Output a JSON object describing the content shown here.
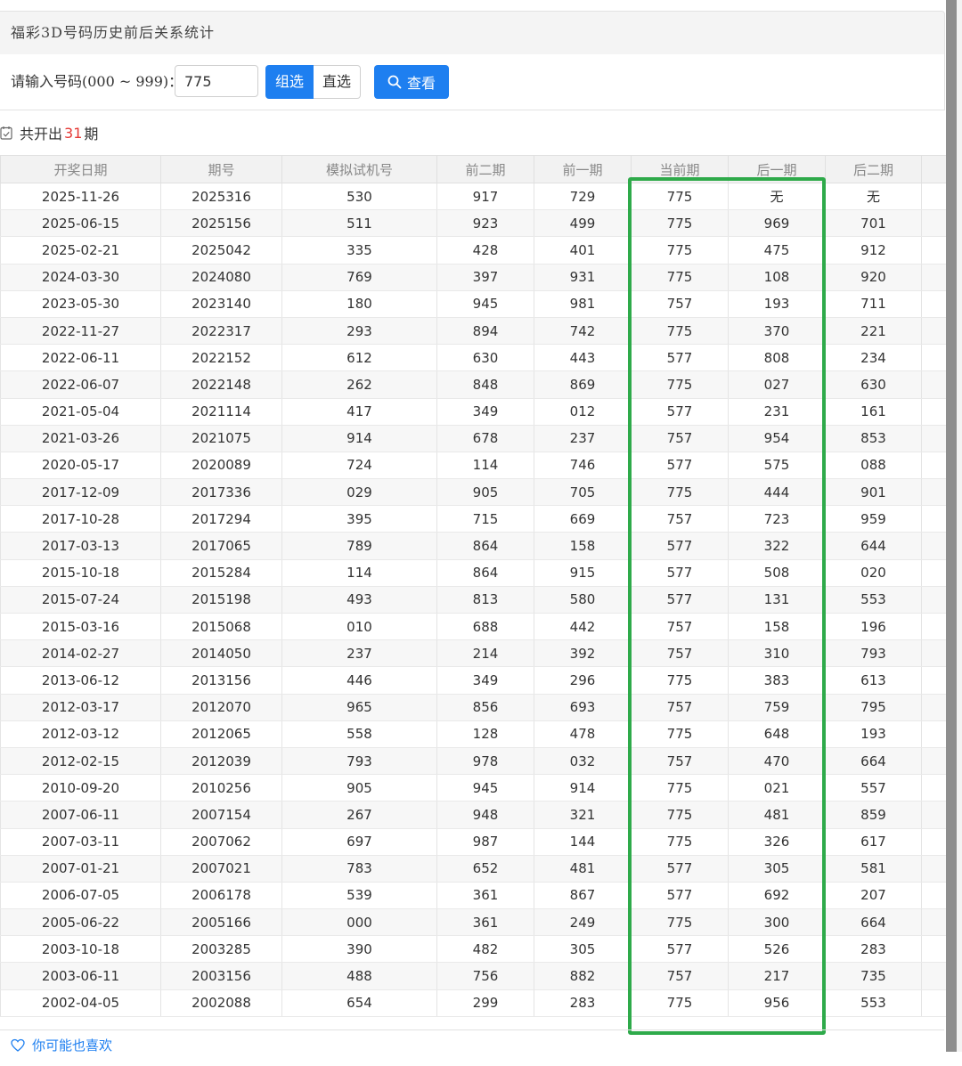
{
  "header": {
    "title": "福彩3D号码历史前后关系统计"
  },
  "query": {
    "label": "请输入号码(000 ~ 999)：",
    "value": "775",
    "group_btn": "组选",
    "direct_btn": "直选",
    "view_btn": "查看"
  },
  "summary": {
    "prefix": "共开出",
    "count": "31",
    "suffix": "期"
  },
  "table": {
    "columns": [
      "开奖日期",
      "期号",
      "模拟试机号",
      "前二期",
      "前一期",
      "当前期",
      "后一期",
      "后二期"
    ],
    "rows": [
      [
        "2025-11-26",
        "2025316",
        "530",
        "917",
        "729",
        "775",
        "无",
        "无"
      ],
      [
        "2025-06-15",
        "2025156",
        "511",
        "923",
        "499",
        "775",
        "969",
        "701"
      ],
      [
        "2025-02-21",
        "2025042",
        "335",
        "428",
        "401",
        "775",
        "475",
        "912"
      ],
      [
        "2024-03-30",
        "2024080",
        "769",
        "397",
        "931",
        "775",
        "108",
        "920"
      ],
      [
        "2023-05-30",
        "2023140",
        "180",
        "945",
        "981",
        "757",
        "193",
        "711"
      ],
      [
        "2022-11-27",
        "2022317",
        "293",
        "894",
        "742",
        "775",
        "370",
        "221"
      ],
      [
        "2022-06-11",
        "2022152",
        "612",
        "630",
        "443",
        "577",
        "808",
        "234"
      ],
      [
        "2022-06-07",
        "2022148",
        "262",
        "848",
        "869",
        "775",
        "027",
        "630"
      ],
      [
        "2021-05-04",
        "2021114",
        "417",
        "349",
        "012",
        "577",
        "231",
        "161"
      ],
      [
        "2021-03-26",
        "2021075",
        "914",
        "678",
        "237",
        "757",
        "954",
        "853"
      ],
      [
        "2020-05-17",
        "2020089",
        "724",
        "114",
        "746",
        "577",
        "575",
        "088"
      ],
      [
        "2017-12-09",
        "2017336",
        "029",
        "905",
        "705",
        "775",
        "444",
        "901"
      ],
      [
        "2017-10-28",
        "2017294",
        "395",
        "715",
        "669",
        "757",
        "723",
        "959"
      ],
      [
        "2017-03-13",
        "2017065",
        "789",
        "864",
        "158",
        "577",
        "322",
        "644"
      ],
      [
        "2015-10-18",
        "2015284",
        "114",
        "864",
        "915",
        "577",
        "508",
        "020"
      ],
      [
        "2015-07-24",
        "2015198",
        "493",
        "813",
        "580",
        "577",
        "131",
        "553"
      ],
      [
        "2015-03-16",
        "2015068",
        "010",
        "688",
        "442",
        "757",
        "158",
        "196"
      ],
      [
        "2014-02-27",
        "2014050",
        "237",
        "214",
        "392",
        "757",
        "310",
        "793"
      ],
      [
        "2013-06-12",
        "2013156",
        "446",
        "349",
        "296",
        "775",
        "383",
        "613"
      ],
      [
        "2012-03-17",
        "2012070",
        "965",
        "856",
        "693",
        "757",
        "759",
        "795"
      ],
      [
        "2012-03-12",
        "2012065",
        "558",
        "128",
        "478",
        "775",
        "648",
        "193"
      ],
      [
        "2012-02-15",
        "2012039",
        "793",
        "978",
        "032",
        "757",
        "470",
        "664"
      ],
      [
        "2010-09-20",
        "2010256",
        "905",
        "945",
        "914",
        "775",
        "021",
        "557"
      ],
      [
        "2007-06-11",
        "2007154",
        "267",
        "948",
        "321",
        "775",
        "481",
        "859"
      ],
      [
        "2007-03-11",
        "2007062",
        "697",
        "987",
        "144",
        "775",
        "326",
        "617"
      ],
      [
        "2007-01-21",
        "2007021",
        "783",
        "652",
        "481",
        "577",
        "305",
        "581"
      ],
      [
        "2006-07-05",
        "2006178",
        "539",
        "361",
        "867",
        "577",
        "692",
        "207"
      ],
      [
        "2005-06-22",
        "2005166",
        "000",
        "361",
        "249",
        "775",
        "300",
        "664"
      ],
      [
        "2003-10-18",
        "2003285",
        "390",
        "482",
        "305",
        "577",
        "526",
        "283"
      ],
      [
        "2003-06-11",
        "2003156",
        "488",
        "756",
        "882",
        "757",
        "217",
        "735"
      ],
      [
        "2002-04-05",
        "2002088",
        "654",
        "299",
        "283",
        "775",
        "956",
        "553"
      ]
    ]
  },
  "footer": {
    "like_text": "你可能也喜欢"
  },
  "colors": {
    "primary": "#1e7ff0",
    "highlight": "#2eaa4a",
    "count": "#e53935"
  }
}
